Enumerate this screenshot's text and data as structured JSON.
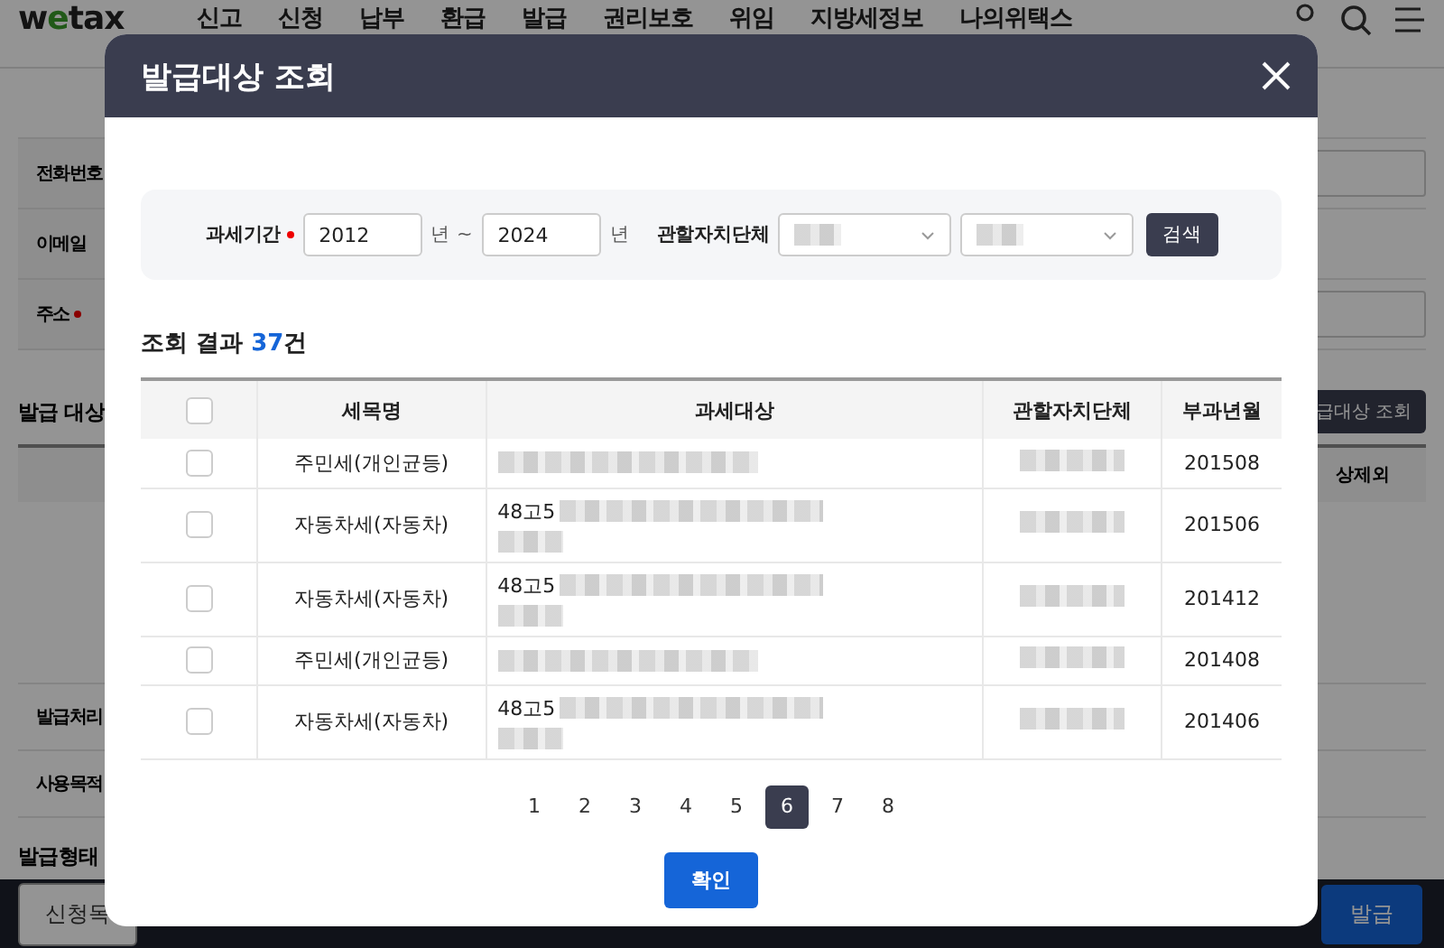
{
  "site_header": {
    "logo": "wetax",
    "nav": [
      "신고",
      "신청",
      "납부",
      "환급",
      "발급",
      "권리보호",
      "위임",
      "지방세정보",
      "나의위택스"
    ]
  },
  "background_page": {
    "form_rows": [
      {
        "label": "전화번호",
        "required": false
      },
      {
        "label": "이메일",
        "required": false
      },
      {
        "label": "주소",
        "required": true
      }
    ],
    "section_title": "발급 대상",
    "lookup_button": "급대상 조회",
    "table_column": "상제외",
    "info_rows": [
      "발급처리",
      "사용목적"
    ],
    "issue_type_title": "발급형태",
    "footer_buttons": [
      {
        "label": "신청목",
        "kind": "outline"
      },
      {
        "label": "발급",
        "kind": "primary"
      }
    ]
  },
  "dialog": {
    "title": "발급대상 조회",
    "search": {
      "period_label": "과세기간",
      "period_required": true,
      "from": "2012",
      "from_unit": "년 ~",
      "to": "2024",
      "to_unit": "년",
      "jurisdiction_label": "관할자치단체",
      "button": "검색"
    },
    "result_label": "조회 결과",
    "result_count": "37",
    "result_unit": "건",
    "columns": [
      "세목명",
      "과세대상",
      "관할자치단체",
      "부과년월"
    ],
    "header_checked": false,
    "rows": [
      {
        "checked": false,
        "tax_item": "주민세(개인균등)",
        "object_prefix": "",
        "period": "201508"
      },
      {
        "checked": false,
        "tax_item": "자동차세(자동차)",
        "object_prefix": "48고5",
        "period": "201506"
      },
      {
        "checked": false,
        "tax_item": "자동차세(자동차)",
        "object_prefix": "48고5",
        "period": "201412"
      },
      {
        "checked": false,
        "tax_item": "주민세(개인균등)",
        "object_prefix": "",
        "period": "201408"
      },
      {
        "checked": false,
        "tax_item": "자동차세(자동차)",
        "object_prefix": "48고5",
        "period": "201406"
      }
    ],
    "pages": [
      {
        "label": "1",
        "selected": false
      },
      {
        "label": "2",
        "selected": false
      },
      {
        "label": "3",
        "selected": false
      },
      {
        "label": "4",
        "selected": false
      },
      {
        "label": "5",
        "selected": false
      },
      {
        "label": "6",
        "selected": true
      },
      {
        "label": "7",
        "selected": false
      },
      {
        "label": "8",
        "selected": false
      }
    ],
    "confirm_button": "확인"
  }
}
